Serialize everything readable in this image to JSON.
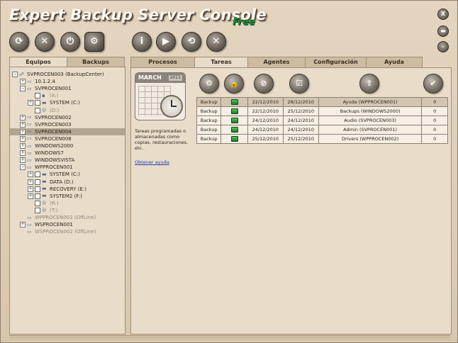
{
  "window": {
    "title": "Expert Backup Server Console",
    "edition": "Free"
  },
  "toolbar": {
    "buttons": [
      {
        "name": "refresh-icon",
        "glyph": "⟳"
      },
      {
        "name": "cancel-icon",
        "glyph": "✕"
      },
      {
        "name": "power-icon",
        "glyph": "⏻"
      },
      {
        "name": "settings-icon",
        "glyph": "⚙"
      },
      {
        "name": "info-icon",
        "glyph": "i"
      },
      {
        "name": "play-icon",
        "glyph": "▶"
      },
      {
        "name": "sync-icon",
        "glyph": "⟲"
      },
      {
        "name": "delete-icon",
        "glyph": "✕"
      }
    ]
  },
  "window_controls": {
    "close": "X",
    "restore": "▬",
    "minimize": "–"
  },
  "left_tabs": [
    {
      "label": "Equipos",
      "active": true
    },
    {
      "label": "Backups",
      "active": false
    }
  ],
  "tree": [
    {
      "label": "SVPROCEN003 (BackupCenter)",
      "indent": 0,
      "exp": "−",
      "icon": "net",
      "state": "normal"
    },
    {
      "label": "10.1.2.4",
      "indent": 1,
      "exp": "+",
      "icon": "pc",
      "state": "normal"
    },
    {
      "label": "SVPROCEN001",
      "indent": 1,
      "exp": "−",
      "icon": "pc",
      "state": "normal"
    },
    {
      "label": "(A:)",
      "indent": 2,
      "exp": "",
      "icon": "floppy",
      "chk": true,
      "state": "off"
    },
    {
      "label": "SYSTEM (C:)",
      "indent": 2,
      "exp": "+",
      "icon": "disk",
      "chk": true,
      "state": "normal"
    },
    {
      "label": "(D:)",
      "indent": 2,
      "exp": "",
      "icon": "cd",
      "chk": true,
      "state": "off"
    },
    {
      "label": "SVPROCEN002",
      "indent": 1,
      "exp": "+",
      "icon": "pc",
      "state": "normal"
    },
    {
      "label": "SVPROCEN003",
      "indent": 1,
      "exp": "+",
      "icon": "pc",
      "state": "normal"
    },
    {
      "label": "SVPROCEN004",
      "indent": 1,
      "exp": "+",
      "icon": "pc",
      "state": "sel"
    },
    {
      "label": "SVPROCEN008",
      "indent": 1,
      "exp": "+",
      "icon": "pc",
      "state": "normal"
    },
    {
      "label": "WINDOWS2000",
      "indent": 1,
      "exp": "+",
      "icon": "pc",
      "state": "normal"
    },
    {
      "label": "WINDOWS7",
      "indent": 1,
      "exp": "+",
      "icon": "pc",
      "state": "normal"
    },
    {
      "label": "WINDOWSVISTA",
      "indent": 1,
      "exp": "+",
      "icon": "pc",
      "state": "normal"
    },
    {
      "label": "WPPROCEN001",
      "indent": 1,
      "exp": "−",
      "icon": "pc",
      "state": "normal"
    },
    {
      "label": "SYSTEM (C:)",
      "indent": 2,
      "exp": "+",
      "icon": "disk",
      "chk": true,
      "state": "normal"
    },
    {
      "label": "DATA (D:)",
      "indent": 2,
      "exp": "+",
      "icon": "disk",
      "chk": true,
      "state": "normal"
    },
    {
      "label": "RECOVERY (E:)",
      "indent": 2,
      "exp": "+",
      "icon": "disk",
      "chk": true,
      "state": "normal"
    },
    {
      "label": "SYSTEM2 (F:)",
      "indent": 2,
      "exp": "+",
      "icon": "disk",
      "chk": true,
      "state": "normal"
    },
    {
      "label": "(R:)",
      "indent": 2,
      "exp": "",
      "icon": "cd",
      "chk": true,
      "state": "off"
    },
    {
      "label": "(T:)",
      "indent": 2,
      "exp": "",
      "icon": "cd",
      "chk": true,
      "state": "off"
    },
    {
      "label": "WPPROCEN002 (OffLine)",
      "indent": 1,
      "exp": "",
      "icon": "pc",
      "state": "off"
    },
    {
      "label": "WSPROCEN001",
      "indent": 1,
      "exp": "+",
      "icon": "pc",
      "state": "normal"
    },
    {
      "label": "WSPROCEN002 (OffLine)",
      "indent": 1,
      "exp": "",
      "icon": "pc",
      "state": "off"
    }
  ],
  "right_tabs": [
    {
      "label": "Procesos",
      "active": false
    },
    {
      "label": "Tareas",
      "active": true
    },
    {
      "label": "Agentes",
      "active": false
    },
    {
      "label": "Configuración",
      "active": false
    },
    {
      "label": "Ayuda",
      "active": false
    }
  ],
  "calendar": {
    "month": "MARCH",
    "year": "2011"
  },
  "description": "Tareas programadas o almacenadas como copias, restauraciones, etc.",
  "help_link": "Obtener ayuda",
  "actions": [
    {
      "name": "gears-icon",
      "glyph": "⚙"
    },
    {
      "name": "lock-icon",
      "glyph": "🔒"
    },
    {
      "name": "block-icon",
      "glyph": "⊘"
    },
    {
      "name": "checklist-icon",
      "glyph": "☑"
    },
    {
      "name": "export-icon",
      "glyph": "⇪"
    },
    {
      "name": "check-icon",
      "glyph": "✔"
    }
  ],
  "tasks": [
    {
      "type": "Backup",
      "start": "22/12/2010",
      "end": "28/12/2010",
      "name": "Ayuda (WPPROCEN001)",
      "count": "0",
      "hl": true
    },
    {
      "type": "Backup",
      "start": "22/12/2010",
      "end": "25/12/2010",
      "name": "Backups (WINDOWS2000)",
      "count": "0",
      "hl": false
    },
    {
      "type": "Backup",
      "start": "24/12/2010",
      "end": "24/12/2010",
      "name": "Audio (SVPROCEN003)",
      "count": "0",
      "hl": false
    },
    {
      "type": "Backup",
      "start": "24/12/2010",
      "end": "24/12/2010",
      "name": "Admin (SVPROCEN001)",
      "count": "0",
      "hl": false
    },
    {
      "type": "Backup",
      "start": "25/12/2010",
      "end": "25/12/2010",
      "name": "Drivers (WPPROCEN002)",
      "count": "0",
      "hl": false
    }
  ]
}
